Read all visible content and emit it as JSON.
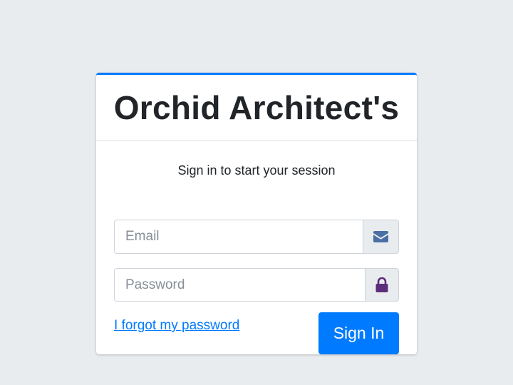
{
  "brand": {
    "title": "Orchid Architect's"
  },
  "login": {
    "message": "Sign in to start your session",
    "email": {
      "placeholder": "Email",
      "value": "",
      "icon": "envelope-icon"
    },
    "password": {
      "placeholder": "Password",
      "value": "",
      "icon": "lock-icon"
    },
    "forgot_label": "I forgot my password",
    "submit_label": "Sign In"
  },
  "colors": {
    "accent": "#007bff",
    "background": "#e9ecef",
    "envelope_icon": "#4a6fa5",
    "lock_icon": "#5c2d7a"
  }
}
